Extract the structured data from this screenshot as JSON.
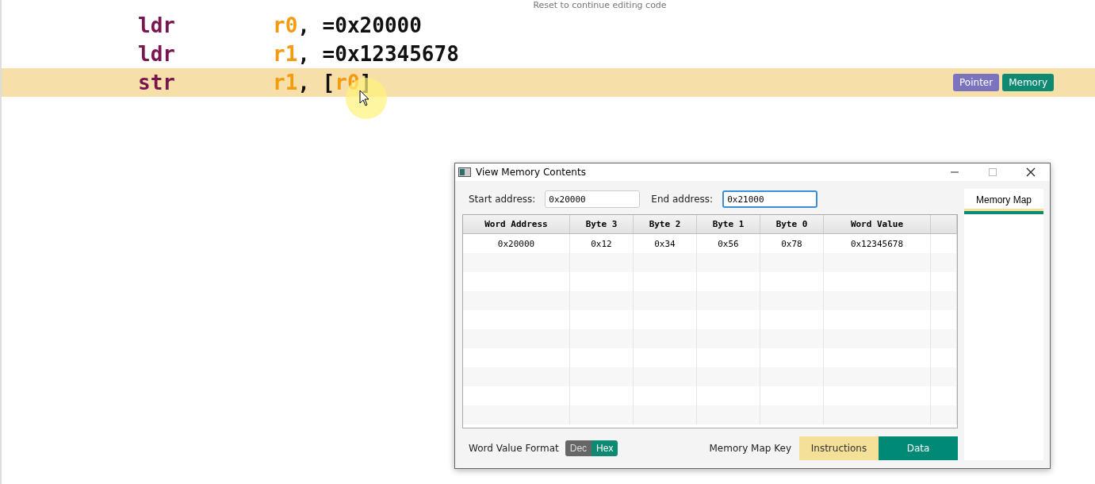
{
  "editor": {
    "hint": "Reset to continue editing code",
    "lines": [
      {
        "mnemonic": "ldr",
        "operands": [
          {
            "text": "r0",
            "kind": "register"
          },
          {
            "text": ", =0x20000",
            "kind": "plain"
          }
        ],
        "highlighted": false
      },
      {
        "mnemonic": "ldr",
        "operands": [
          {
            "text": "r1",
            "kind": "register"
          },
          {
            "text": ", =0x12345678",
            "kind": "plain"
          }
        ],
        "highlighted": false
      },
      {
        "mnemonic": "str",
        "operands": [
          {
            "text": "r1",
            "kind": "register"
          },
          {
            "text": ", [",
            "kind": "plain"
          },
          {
            "text": "r0",
            "kind": "register"
          },
          {
            "text": "]",
            "kind": "plain"
          }
        ],
        "highlighted": true,
        "buttons": [
          {
            "label": "Pointer",
            "color": "#7b72c0"
          },
          {
            "label": "Memory",
            "color": "#0e8a73"
          }
        ]
      }
    ]
  },
  "dialog": {
    "title": "View Memory Contents",
    "start_label": "Start address:",
    "start_value": "0x20000",
    "end_label": "End address:",
    "end_value": "0x21000",
    "end_focused": true,
    "table": {
      "columns": [
        "Word Address",
        "Byte 3",
        "Byte 2",
        "Byte 1",
        "Byte 0",
        "Word Value"
      ],
      "rows": [
        [
          "0x20000",
          "0x12",
          "0x34",
          "0x56",
          "0x78",
          "0x12345678"
        ]
      ]
    },
    "tabs": [
      {
        "label": "Memory Map",
        "selected": true
      }
    ],
    "format_label": "Word Value Format",
    "format_options": [
      {
        "label": "Dec",
        "selected": false
      },
      {
        "label": "Hex",
        "selected": true
      }
    ],
    "key_label": "Memory Map Key",
    "key_items": [
      {
        "label": "Instructions",
        "color": "#f5e09a"
      },
      {
        "label": "Data",
        "color": "#008a76"
      }
    ]
  }
}
